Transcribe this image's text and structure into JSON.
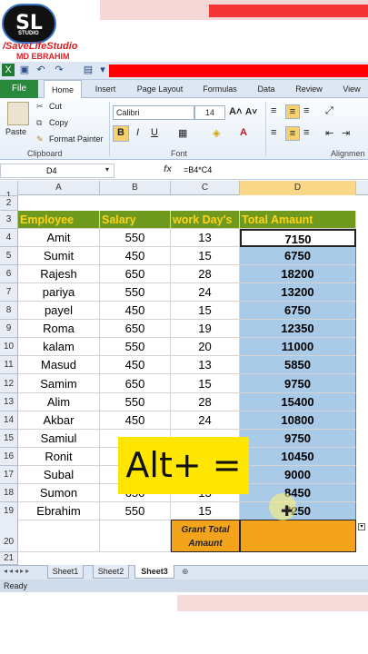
{
  "brand": {
    "logo": "SL",
    "logo_sub": "STUDIO",
    "channel": "/SaveLifeStudio",
    "author": "MD EBRAHIM"
  },
  "tabs": [
    {
      "label": "File"
    },
    {
      "label": "Home"
    },
    {
      "label": "Insert"
    },
    {
      "label": "Page Layout"
    },
    {
      "label": "Formulas"
    },
    {
      "label": "Data"
    },
    {
      "label": "Review"
    },
    {
      "label": "View"
    }
  ],
  "ribbon": {
    "paste": "Paste",
    "cut": "Cut",
    "copy": "Copy",
    "format_painter": "Format Painter",
    "clipboard": "Clipboard",
    "font_name": "Calibri",
    "font_size": "14",
    "font_group": "Font",
    "alignment_group": "Alignmen",
    "bold": "B",
    "italic": "I",
    "underline": "U"
  },
  "formula_bar": {
    "name_box": "D4",
    "fx": "fx",
    "formula": "=B4*C4"
  },
  "columns": [
    "A",
    "B",
    "C",
    "D"
  ],
  "headers": {
    "employee": "Employee",
    "salary": "Salary",
    "work_days": "work Day's",
    "total": "Total Amaunt"
  },
  "rows": [
    {
      "n": "4",
      "name": "Amit",
      "salary": "550",
      "days": "13",
      "total": "7150"
    },
    {
      "n": "5",
      "name": "Sumit",
      "salary": "450",
      "days": "15",
      "total": "6750"
    },
    {
      "n": "6",
      "name": "Rajesh",
      "salary": "650",
      "days": "28",
      "total": "18200"
    },
    {
      "n": "7",
      "name": "pariya",
      "salary": "550",
      "days": "24",
      "total": "13200"
    },
    {
      "n": "8",
      "name": "payel",
      "salary": "450",
      "days": "15",
      "total": "6750"
    },
    {
      "n": "9",
      "name": "Roma",
      "salary": "650",
      "days": "19",
      "total": "12350"
    },
    {
      "n": "10",
      "name": "kalam",
      "salary": "550",
      "days": "20",
      "total": "11000"
    },
    {
      "n": "11",
      "name": "Masud",
      "salary": "450",
      "days": "13",
      "total": "5850"
    },
    {
      "n": "12",
      "name": "Samim",
      "salary": "650",
      "days": "15",
      "total": "9750"
    },
    {
      "n": "13",
      "name": "Alim",
      "salary": "550",
      "days": "28",
      "total": "15400"
    },
    {
      "n": "14",
      "name": "Akbar",
      "salary": "450",
      "days": "24",
      "total": "10800"
    },
    {
      "n": "15",
      "name": "Samiul",
      "salary": "",
      "days": "",
      "total": "9750"
    },
    {
      "n": "16",
      "name": "Ronit",
      "salary": "",
      "days": "",
      "total": "10450"
    },
    {
      "n": "17",
      "name": "Subal",
      "salary": "",
      "days": "",
      "total": "9000"
    },
    {
      "n": "18",
      "name": "Sumon",
      "salary": "650",
      "days": "13",
      "total": "8450"
    },
    {
      "n": "19",
      "name": "Ebrahim",
      "salary": "550",
      "days": "15",
      "total": "7250"
    }
  ],
  "row_numbers": {
    "r1": "1",
    "r2": "2",
    "r3": "3",
    "r20": "20",
    "r21": "21"
  },
  "grant_total": {
    "line1": "Grant Total",
    "line2": "Amaunt"
  },
  "sheets": [
    {
      "label": "Sheet1"
    },
    {
      "label": "Sheet2"
    },
    {
      "label": "Sheet3"
    }
  ],
  "status": "Ready",
  "overlay": "Alt+ =",
  "colors": {
    "header_bg": "#6f9a1d",
    "header_text": "#ffd21a",
    "selection": "#a9cbe8",
    "grant": "#f4a41b",
    "file_tab": "#2a8a3b"
  }
}
